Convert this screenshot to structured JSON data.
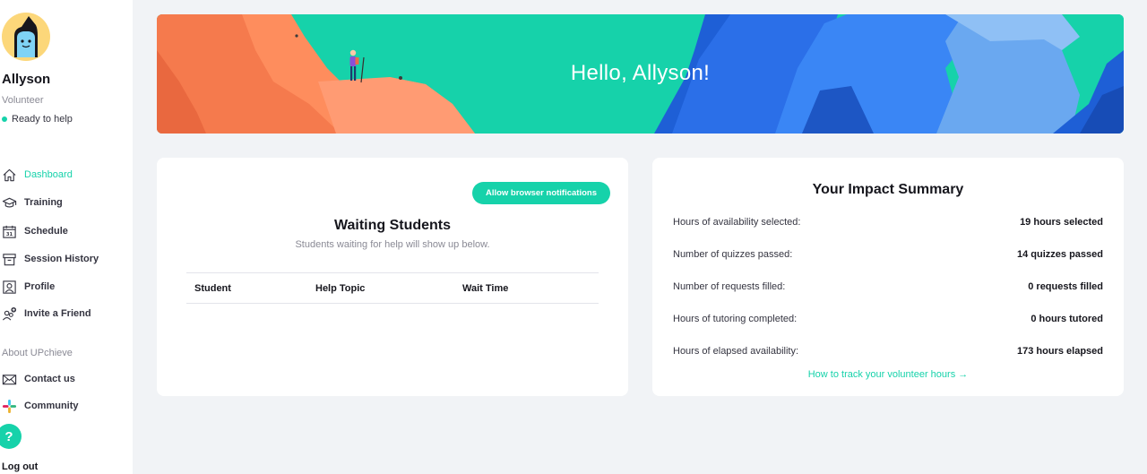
{
  "user": {
    "name": "Allyson",
    "role": "Volunteer",
    "status": "Ready to help"
  },
  "nav": {
    "items": [
      {
        "label": "Dashboard",
        "icon": "home-icon",
        "active": true
      },
      {
        "label": "Training",
        "icon": "graduation-cap-icon"
      },
      {
        "label": "Schedule",
        "icon": "calendar-icon"
      },
      {
        "label": "Session History",
        "icon": "archive-icon"
      },
      {
        "label": "Profile",
        "icon": "profile-icon"
      },
      {
        "label": "Invite a Friend",
        "icon": "invite-friend-icon"
      }
    ],
    "about_label": "About UPchieve",
    "about_items": [
      {
        "label": "Contact us",
        "icon": "envelope-icon"
      },
      {
        "label": "Community",
        "icon": "slack-icon"
      }
    ],
    "help_glyph": "?",
    "logout_label": "Log out"
  },
  "banner": {
    "title": "Hello, Allyson!"
  },
  "waiting": {
    "notif_button": "Allow browser notifications",
    "title": "Waiting Students",
    "subtitle": "Students waiting for help will show up below.",
    "columns": [
      "Student",
      "Help Topic",
      "Wait Time"
    ]
  },
  "impact": {
    "title": "Your Impact Summary",
    "rows": [
      {
        "label": "Hours of availability selected:",
        "value": "19 hours selected"
      },
      {
        "label": "Number of quizzes passed:",
        "value": "14 quizzes passed"
      },
      {
        "label": "Number of requests filled:",
        "value": "0 requests filled"
      },
      {
        "label": "Hours of tutoring completed:",
        "value": "0 hours tutored"
      },
      {
        "label": "Hours of elapsed availability:",
        "value": "173 hours elapsed"
      }
    ],
    "link": "How to track your volunteer hours →"
  },
  "colors": {
    "accent": "#16d2aa",
    "background": "#f1f3f6"
  }
}
